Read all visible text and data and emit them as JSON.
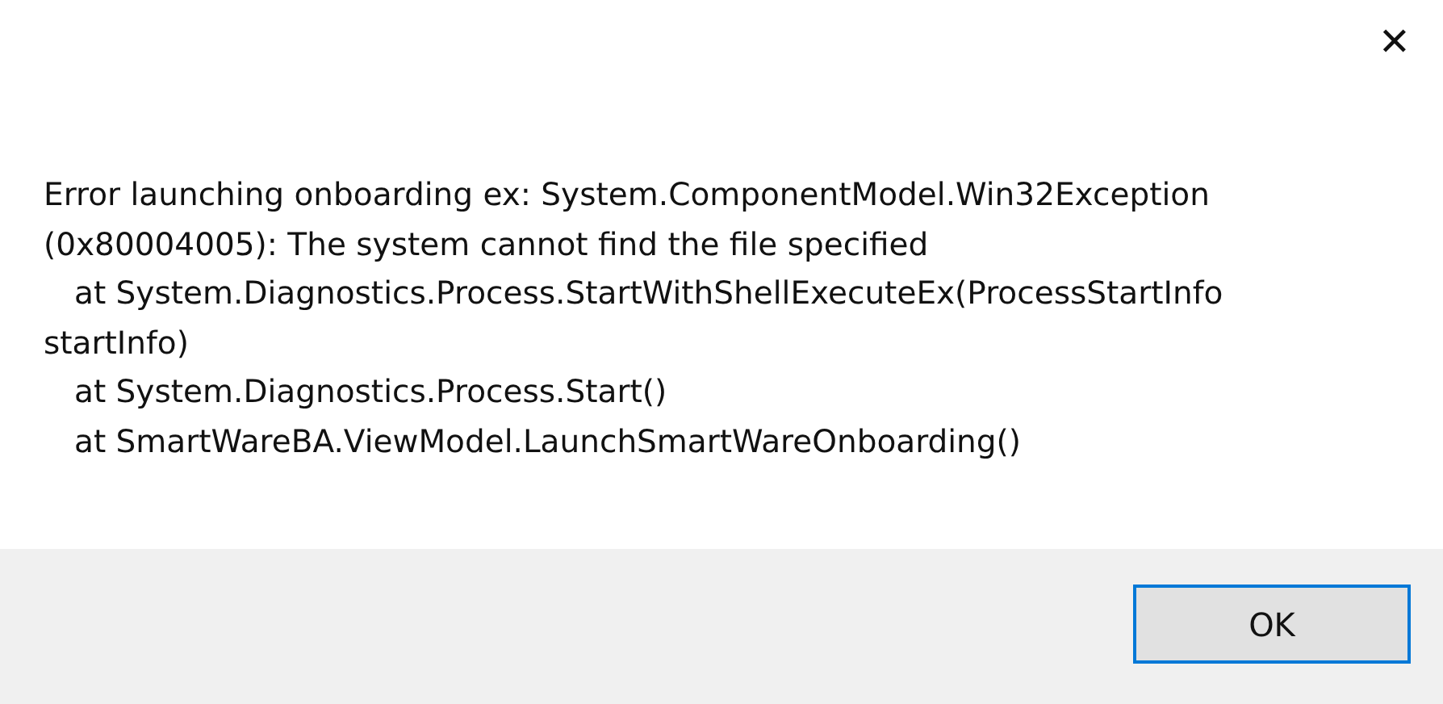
{
  "dialog": {
    "close_glyph": "✕",
    "message_lines": [
      {
        "kind": "text",
        "text": "Error launching onboarding ex: System.ComponentModel.Win32Exception"
      },
      {
        "kind": "text",
        "text": "(0x80004005): The system cannot find the file specified"
      },
      {
        "kind": "frame",
        "text": "at System.Diagnostics.Process.StartWithShellExecuteEx(ProcessStartInfo"
      },
      {
        "kind": "text",
        "text": "startInfo)"
      },
      {
        "kind": "frame",
        "text": "at System.Diagnostics.Process.Start()"
      },
      {
        "kind": "frame",
        "text": "at SmartWareBA.ViewModel.LaunchSmartWareOnboarding()"
      }
    ],
    "buttons": [
      {
        "label": "OK",
        "selected": true
      }
    ]
  }
}
